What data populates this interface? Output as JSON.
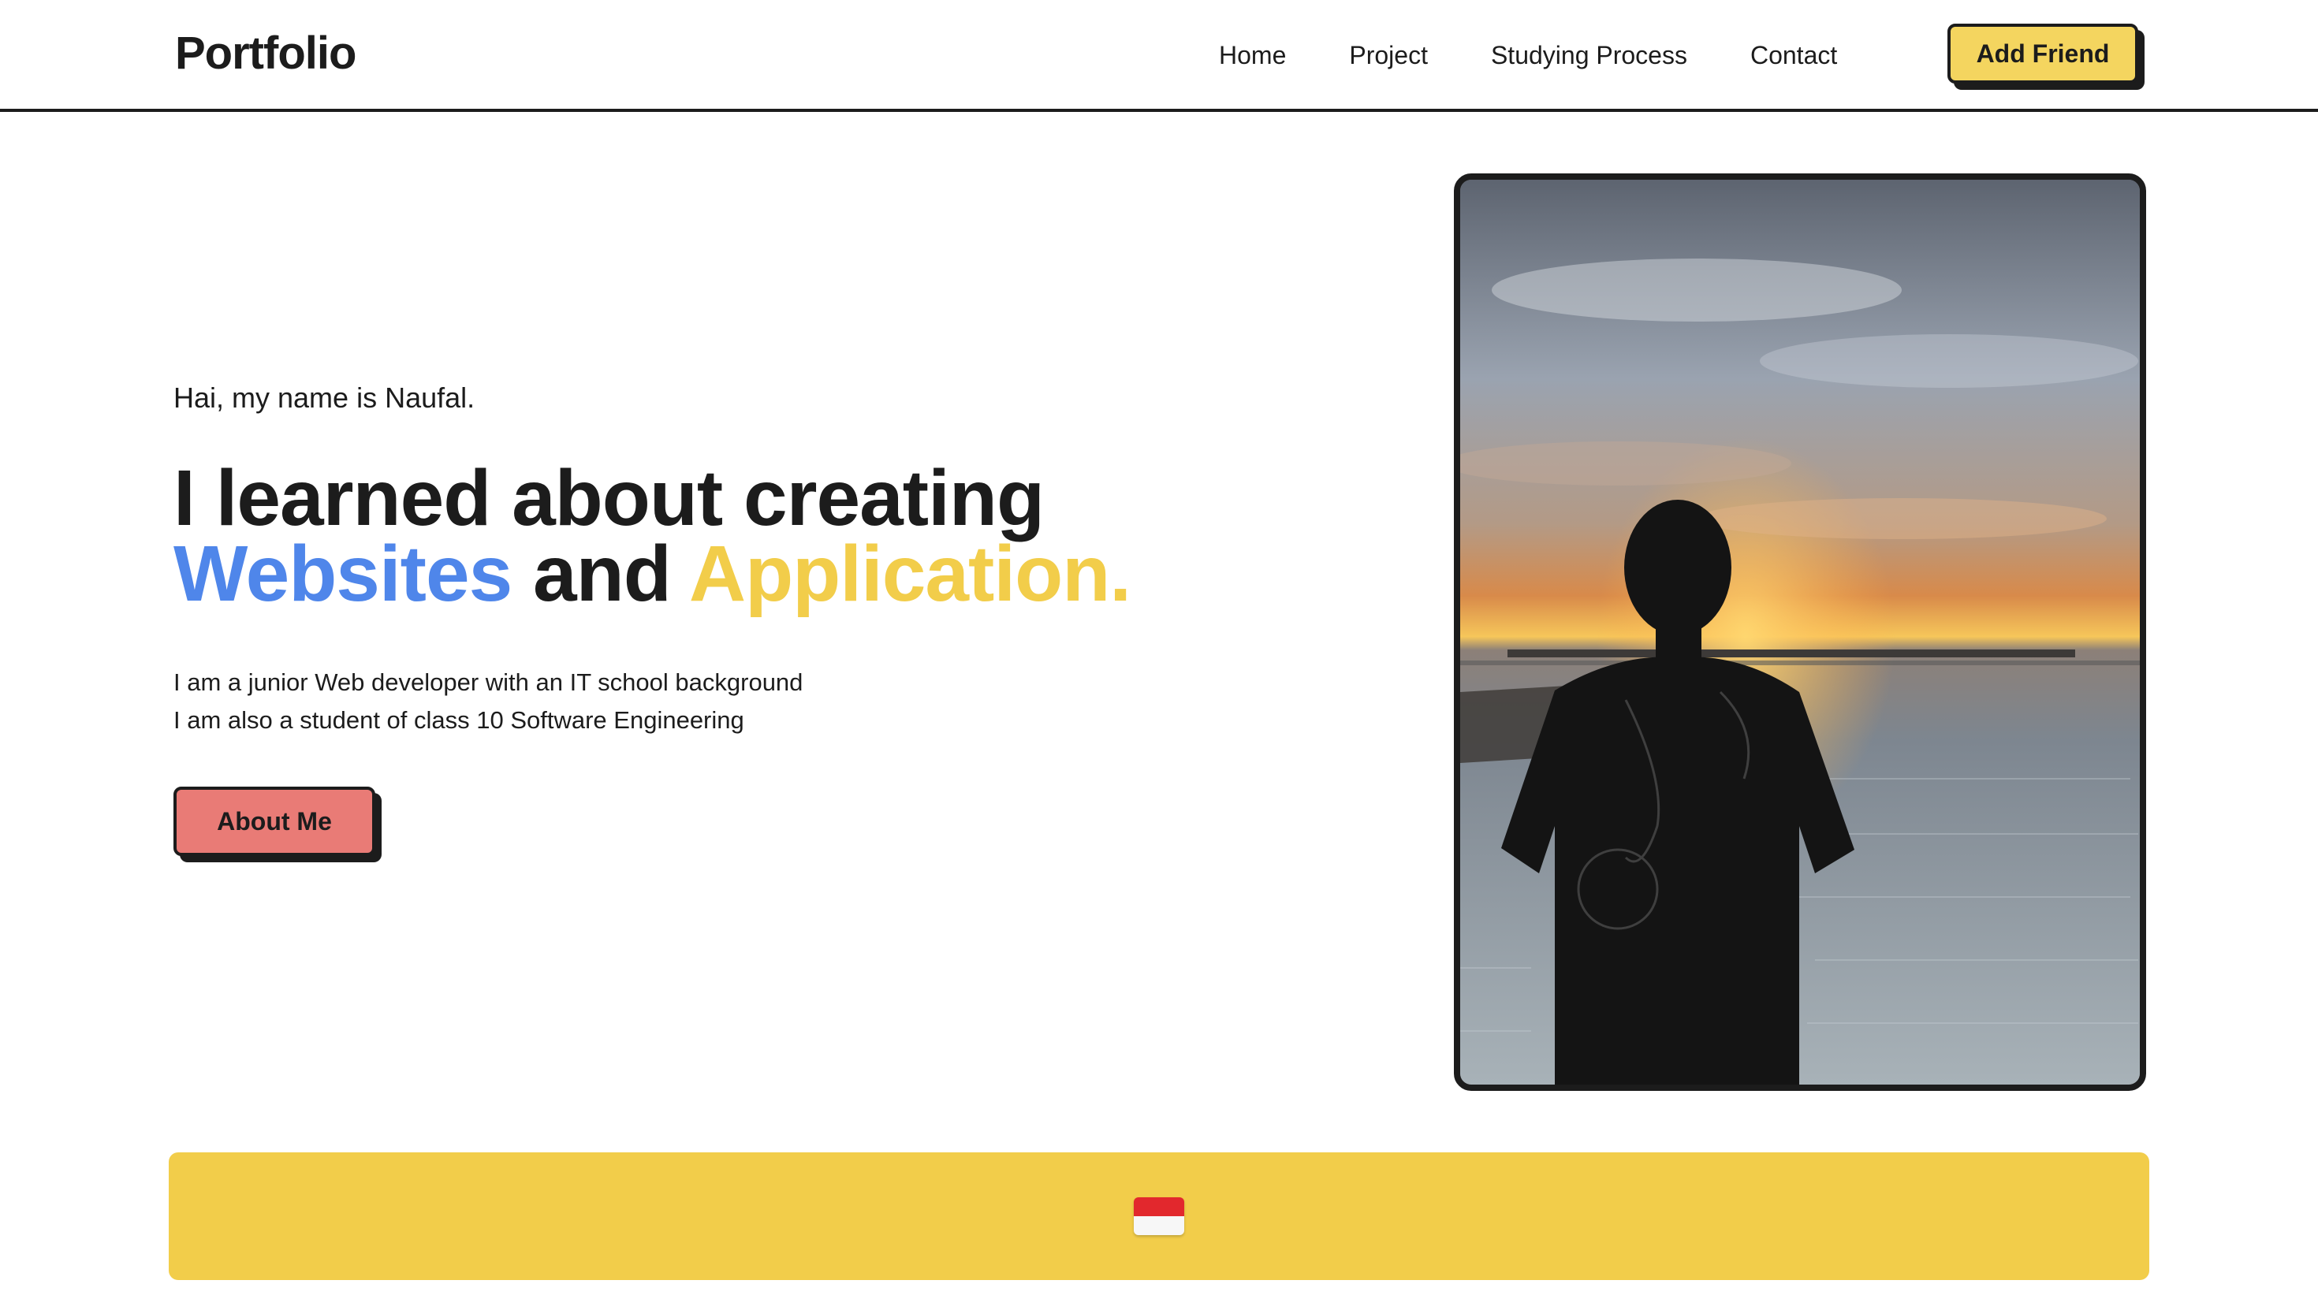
{
  "navbar": {
    "logo": "Portfolio",
    "links": [
      "Home",
      "Project",
      "Studying Process",
      "Contact"
    ],
    "cta_label": "Add Friend"
  },
  "hero": {
    "greeting": "Hai, my name is Naufal.",
    "headline_line1": "I learned about creating",
    "headline_word_blue": "Websites",
    "headline_word_and": " and ",
    "headline_word_yellow": "Application.",
    "bio_line1": "I am a junior Web developer with an IT school background",
    "bio_line2": "I am also a student of class 10 Software Engineering",
    "button_label": "About Me"
  },
  "photo": {
    "icon": "person-silhouette-sunset-photo"
  },
  "footer_band": {
    "icon": "indonesia-flag-icon"
  },
  "colors": {
    "accent_yellow": "#f2cd4a",
    "accent_blue": "#4f86ea",
    "button_red": "#e97b76",
    "ink": "#1c1c1c"
  }
}
